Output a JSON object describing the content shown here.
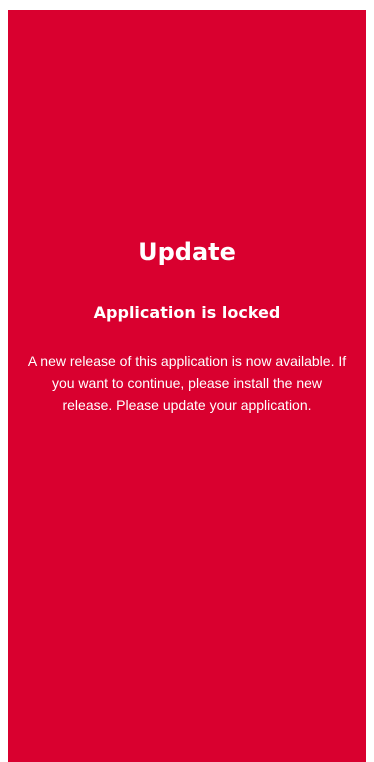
{
  "colors": {
    "background": "#d9002f",
    "text": "#ffffff"
  },
  "lock_screen": {
    "title": "Update",
    "subtitle": "Application is locked",
    "message": "A new release of this application is now available. If you want to continue, please install the new release. Please update your application."
  }
}
